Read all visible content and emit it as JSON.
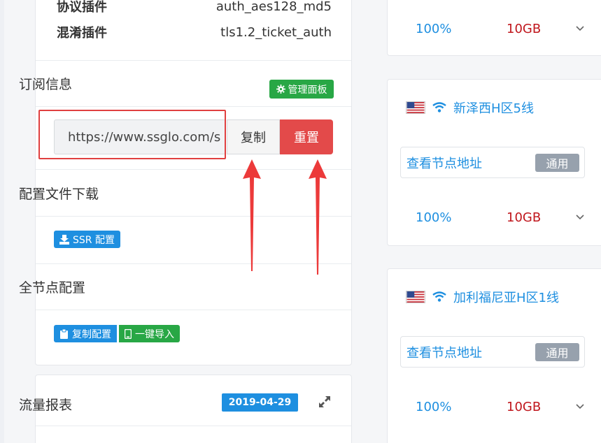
{
  "server_info": {
    "protocol_label": "协议插件",
    "protocol_value": "auth_aes128_md5",
    "obfs_label": "混淆插件",
    "obfs_value": "tls1.2_ticket_auth"
  },
  "subscription": {
    "title": "订阅信息",
    "admin_button": "管理面板",
    "url_value": "https://www.ssglo.com/s",
    "copy_button": "复制",
    "reset_button": "重置"
  },
  "config_download": {
    "title": "配置文件下载",
    "ssr_button": "SSR 配置"
  },
  "all_nodes": {
    "title": "全节点配置",
    "copy_config_button": "复制配置",
    "one_click_import_button": "一键导入"
  },
  "traffic_report": {
    "title": "流量报表",
    "date": "2019-04-29"
  },
  "nodes": [
    {
      "pct": "100%",
      "traffic": "10GB"
    },
    {
      "name": "新泽西H区5线",
      "addr_label": "查看节点地址",
      "tag": "通用",
      "pct": "100%",
      "traffic": "10GB"
    },
    {
      "name": "加利福尼亚H区1线",
      "addr_label": "查看节点地址",
      "tag": "通用",
      "pct": "100%",
      "traffic": "10GB"
    }
  ],
  "colors": {
    "primary": "#1e8fe0",
    "success": "#28a745",
    "danger": "#e34a4a",
    "traffic_red": "#c0161c",
    "tag_gray": "#97a1ad"
  }
}
